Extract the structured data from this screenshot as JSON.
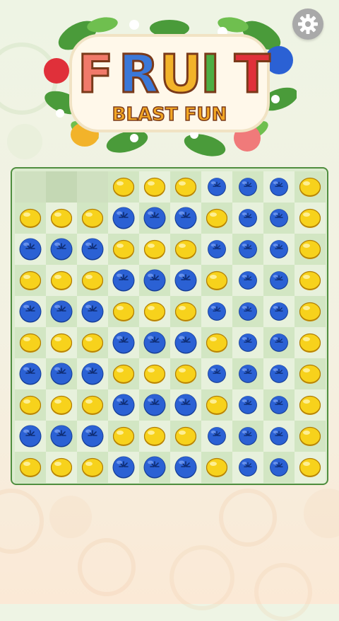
{
  "logo": {
    "title": "FRUIT",
    "subtitle": "BLAST FUN",
    "letter_colors": [
      "#f07a6a",
      "#3a78d8",
      "#f2b32a",
      "#4cae43",
      "#e0303a"
    ]
  },
  "colors": {
    "lemon": "#f7d21c",
    "blueberry": "#2b61d4",
    "board_border": "#4f8e3f",
    "settings_bg": "#a9a9a9"
  },
  "icons": {
    "settings": "gear-icon",
    "lemon": "lemon-icon",
    "blueberry": "blueberry-icon"
  },
  "board": {
    "rows": 10,
    "cols": 10,
    "grid": [
      [
        "E",
        "E",
        "E",
        "L",
        "L",
        "L",
        "b",
        "b",
        "b",
        "L"
      ],
      [
        "L",
        "L",
        "L",
        "B",
        "B",
        "B",
        "L",
        "b",
        "b",
        "L"
      ],
      [
        "B",
        "B",
        "B",
        "L",
        "L",
        "L",
        "b",
        "b",
        "b",
        "L"
      ],
      [
        "L",
        "L",
        "L",
        "B",
        "B",
        "B",
        "L",
        "b",
        "b",
        "L"
      ],
      [
        "B",
        "B",
        "B",
        "L",
        "L",
        "L",
        "b",
        "b",
        "b",
        "L"
      ],
      [
        "L",
        "L",
        "L",
        "B",
        "B",
        "B",
        "L",
        "b",
        "b",
        "L"
      ],
      [
        "B",
        "B",
        "B",
        "L",
        "L",
        "L",
        "b",
        "b",
        "b",
        "L"
      ],
      [
        "L",
        "L",
        "L",
        "B",
        "B",
        "B",
        "L",
        "b",
        "b",
        "L"
      ],
      [
        "B",
        "B",
        "B",
        "L",
        "L",
        "L",
        "b",
        "b",
        "b",
        "L"
      ],
      [
        "L",
        "L",
        "L",
        "B",
        "B",
        "B",
        "L",
        "b",
        "b",
        "L"
      ]
    ]
  }
}
